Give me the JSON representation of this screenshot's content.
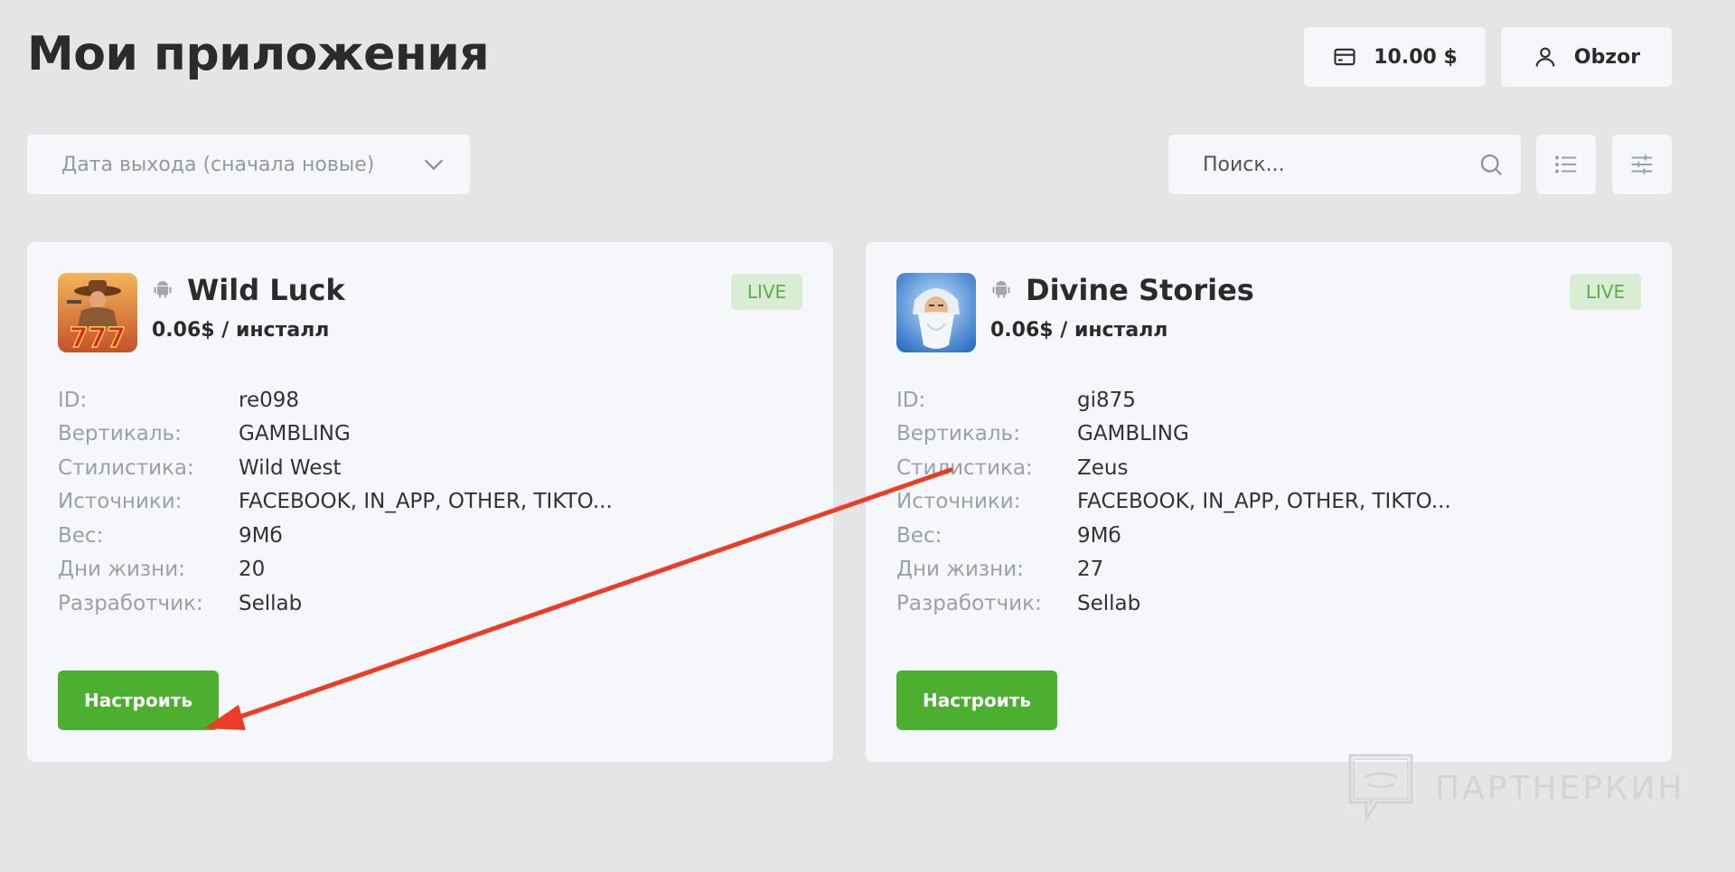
{
  "page": {
    "title": "Мои приложения"
  },
  "header": {
    "balance": "10.00 $",
    "account_name": "Obzor"
  },
  "toolbar": {
    "sort_value": "Дата выхода (сначала новые)",
    "search_placeholder": "Поиск..."
  },
  "labels": {
    "id": "ID:",
    "vertical": "Вертикаль:",
    "style": "Стилистика:",
    "sources": "Источники:",
    "weight": "Вес:",
    "life_days": "Дни жизни:",
    "developer": "Разработчик:",
    "configure": "Настроить"
  },
  "apps": [
    {
      "name": "Wild Luck",
      "price": "0.06$ / инсталл",
      "status": "LIVE",
      "id": "re098",
      "vertical": "GAMBLING",
      "style": "Wild West",
      "sources": "FACEBOOK, IN_APP, OTHER, TIKTO...",
      "weight": "9Мб",
      "life_days": "20",
      "developer": "Sellab",
      "icon": "cowboy-777-icon"
    },
    {
      "name": "Divine Stories",
      "price": "0.06$ / инсталл",
      "status": "LIVE",
      "id": "gi875",
      "vertical": "GAMBLING",
      "style": "Zeus",
      "sources": "FACEBOOK, IN_APP, OTHER, TIKTO...",
      "weight": "9Мб",
      "life_days": "27",
      "developer": "Sellab",
      "icon": "zeus-icon"
    }
  ],
  "watermark": {
    "text": "ПАРТНЕРКИН"
  },
  "colors": {
    "background": "#e5e5e5",
    "card": "#f6f7fa",
    "accent_green": "#4caf2f",
    "live_badge_bg": "#d8edd3",
    "live_badge_text": "#5fae4a",
    "annotation_arrow": "#ee3b24"
  }
}
